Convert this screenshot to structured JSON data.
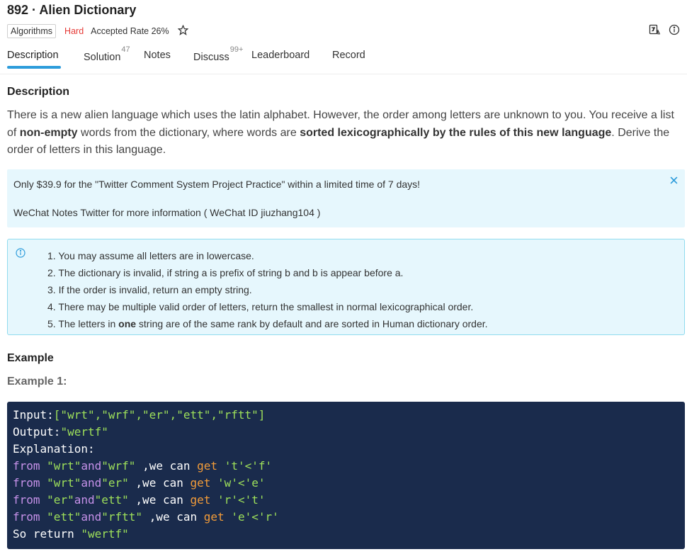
{
  "problem": {
    "title": "892 · Alien Dictionary",
    "tag": "Algorithms",
    "difficulty": "Hard",
    "accepted_rate": "Accepted Rate 26%"
  },
  "tabs": [
    {
      "label": "Description",
      "count": ""
    },
    {
      "label": "Solution",
      "count": "47"
    },
    {
      "label": "Notes",
      "count": ""
    },
    {
      "label": "Discuss",
      "count": "99+"
    },
    {
      "label": "Leaderboard",
      "count": ""
    },
    {
      "label": "Record",
      "count": ""
    }
  ],
  "description": {
    "heading": "Description",
    "p1": "There is a new alien language which uses the latin alphabet. However, the order among letters are unknown to you. You receive a list of ",
    "b1": "non-empty",
    "p2": " words from the dictionary, where words are ",
    "b2": "sorted lexicographically by the rules of this new language",
    "p3": ". Derive the order of letters in this language."
  },
  "promo": {
    "line1": "Only $39.9 for the \"Twitter Comment System Project Practice\" within a limited time of 7 days!",
    "line2": "WeChat Notes Twitter for more information ( WeChat ID jiuzhang104 )"
  },
  "notes": [
    "1. You may assume all letters are in lowercase.",
    "2. The dictionary is invalid, if string a is prefix of string b and b is appear before a.",
    "3. If the order is invalid, return an empty string.",
    "4. There may be multiple valid order of letters, return the smallest in normal lexicographical order."
  ],
  "note5": {
    "pre": "5. The letters in ",
    "bold": "one",
    "post": " string are of the same rank by default and are sorted in Human dictionary order."
  },
  "example": {
    "heading": "Example",
    "sub": "Example 1:",
    "input_label": "Input:",
    "input_value": "[\"wrt\",\"wrf\",\"er\",\"ett\",\"rftt\"]",
    "output_label": "Output:",
    "output_value": "\"wertf\"",
    "explanation": "Explanation:",
    "from": "from",
    "and": "and",
    "we_can": ",we can",
    "get": "get",
    "rows": [
      {
        "a": "\"wrt\"",
        "b": "\"wrf\"",
        "pad": " ",
        "rel": "'t'<'f'"
      },
      {
        "a": "\"wrt\"",
        "b": "\"er\"",
        "pad": " ",
        "rel": "'w'<'e'"
      },
      {
        "a": "\"er\"",
        "b": "\"ett\"",
        "pad": " ",
        "rel": "'r'<'t'"
      },
      {
        "a": "\"ett\"",
        "b": "\"rftt\"",
        "pad": " ",
        "rel": "'e'<'r'"
      }
    ],
    "final_prefix": "So return ",
    "final_value": "\"wertf\""
  },
  "colors": {
    "accent": "#2d9cdb",
    "hard": "#e53935",
    "code_bg": "#1a2b4c",
    "promo_bg": "#e6f7fd"
  }
}
